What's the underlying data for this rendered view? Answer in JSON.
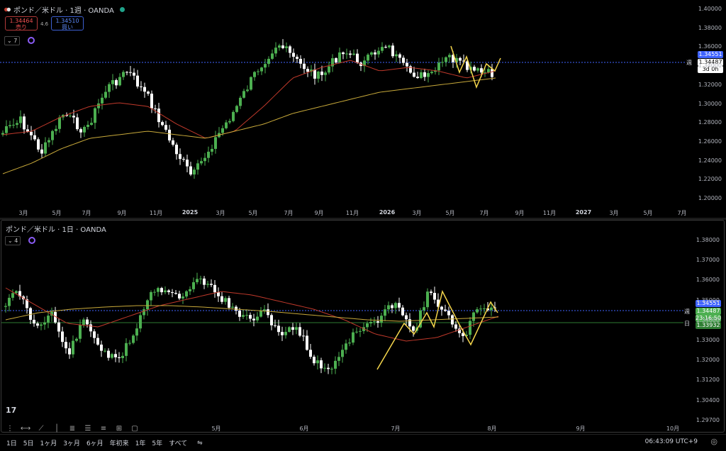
{
  "top": {
    "title": "ポンド／米ドル · 1週 · OANDA",
    "sell_price": "1.34464",
    "sell_label": "売り",
    "buy_price": "1.34510",
    "buy_label": "買い",
    "spread": "4.6",
    "indicator_count": "7",
    "y_ticks": [
      "1.40000",
      "1.38000",
      "1.36000",
      "1.34000",
      "1.32000",
      "1.30000",
      "1.28000",
      "1.26000",
      "1.24000",
      "1.22000",
      "1.20000"
    ],
    "x_ticks": [
      "3月",
      "5月",
      "7月",
      "9月",
      "11月",
      "2025",
      "3月",
      "5月",
      "7月",
      "9月",
      "11月",
      "2026",
      "3月",
      "5月",
      "7月",
      "9月",
      "11月",
      "2027",
      "3月",
      "5月",
      "7月"
    ],
    "price_tag_blue": "1.34551",
    "price_tag_white": "1.34487",
    "countdown": "3d 0h",
    "tag_label": "週"
  },
  "bottom": {
    "title": "ポンド／米ドル · 1日 · OANDA",
    "indicator_count": "4",
    "y_ticks": [
      "1.38000",
      "1.37000",
      "1.36000",
      "1.35000",
      "1.34000",
      "1.33000",
      "1.32000",
      "1.31200",
      "1.30400",
      "1.29700"
    ],
    "x_ticks": [
      "5月",
      "6月",
      "7月",
      "8月",
      "9月",
      "10月"
    ],
    "price_tag_blue": "1.34551",
    "price_tag_white": "1.34487",
    "countdown": "23:16:50",
    "price_tag_green": "1.33932",
    "tag_week": "週",
    "tag_day": "日"
  },
  "timeframes": [
    "1日",
    "5日",
    "1ヶ月",
    "3ヶ月",
    "6ヶ月",
    "年初来",
    "1年",
    "5年",
    "すべて"
  ],
  "clock": "06:43:09 UTC+9",
  "colors": {
    "up": "#4caf50",
    "down": "#ffffff",
    "ma_red": "#c0392b",
    "ma_yellow": "#c8a93a",
    "hline_blue": "#3f63ff",
    "hline_green": "#2e7d32",
    "zigzag": "#f5d64c"
  }
}
